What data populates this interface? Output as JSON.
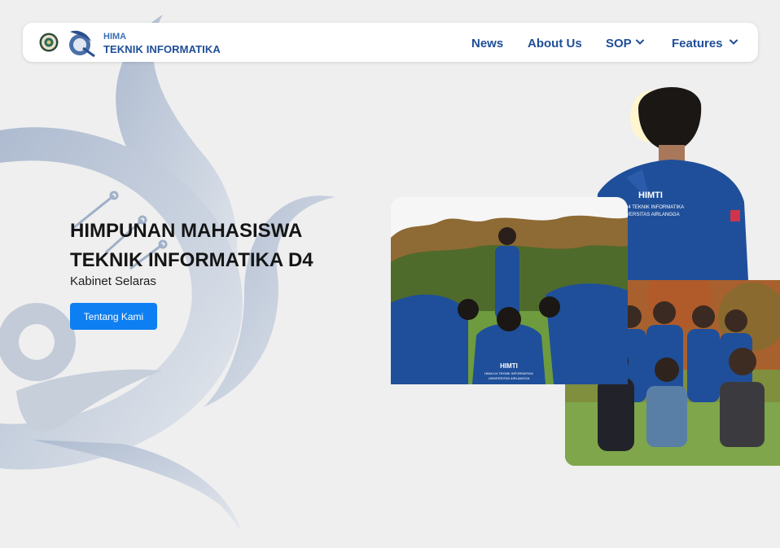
{
  "brand": {
    "top_label": "HIMA",
    "bottom_label": "TEKNIK INFORMATIKA",
    "primary_color": "#1f4e98",
    "secondary_color": "#3b6fb4",
    "logos": [
      "university-seal-icon",
      "hima-logo-icon"
    ]
  },
  "nav": {
    "items": [
      {
        "label": "News"
      },
      {
        "label": "About Us"
      },
      {
        "label": "SOP",
        "has_dropdown": true
      },
      {
        "label": "Features",
        "has_dropdown": true
      }
    ],
    "dropdown_icon": "chevron-down-icon"
  },
  "hero": {
    "title_line1": "HIMPUNAN MAHASISWA",
    "title_line2": "TEKNIK INFORMATIKA D4",
    "subtitle": "Kabinet Selaras",
    "cta_label": "Tentang Kami",
    "cta_color": "#0d7ff2"
  },
  "photos": {
    "back_jacket_text": [
      "HIMTI",
      "D4 TEKNIK INFORMATIKA",
      "VERSITAS AIRLANGGA"
    ],
    "front_jacket_text": [
      "HIMTI",
      "HIMA D4 TEKNIK INFORMATIKA",
      "UNIVERSITAS AIRLANGGA"
    ]
  },
  "colors": {
    "background": "#efefef",
    "decor_swirl": "#b9c4d6"
  }
}
